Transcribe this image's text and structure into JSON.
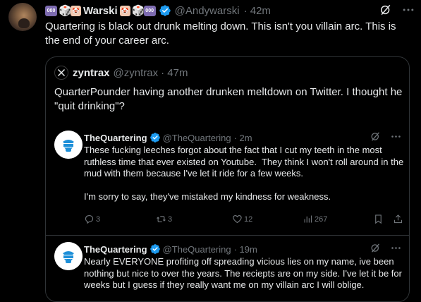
{
  "tweet": {
    "display_name": "Warski",
    "handle": "@Andywarski",
    "time": "· 42m",
    "name_emojis": [
      "000",
      "🎲",
      "🤡",
      "🤡",
      "🎲",
      "000"
    ],
    "text": "Quartering is black out drunk melting down. This isn't you villain arc. This is the end of your career arc."
  },
  "quote": {
    "display_name": "zyntrax",
    "handle": "@zyntrax",
    "time": "· 47m",
    "text": "QuarterPounder having another drunken meltdown on Twitter. I thought he \"quit drinking\"?"
  },
  "inner_tweets": [
    {
      "display_name": "TheQuartering",
      "handle": "@TheQuartering",
      "time": "· 2m",
      "text": "These fucking leeches forgot about the fact that I cut my teeth in the most ruthless time that ever existed on Youtube.  They think I won't roll around in the mud with them because I've let it ride for a few weeks.\n\nI'm sorry to say, they've mistaked my kindness for weakness.",
      "actions": {
        "replies": "3",
        "reposts": "3",
        "likes": "12",
        "views": "267"
      }
    },
    {
      "display_name": "TheQuartering",
      "handle": "@TheQuartering",
      "time": "· 19m",
      "text": "Nearly EVERYONE profiting off spreading vicious lies on my name, ive been nothing but nice to over the years. The reciepts are on my side. I've let it be for weeks but I guess if they really want me on my villain arc I will oblige."
    }
  ],
  "colors": {
    "background": "#000000",
    "text": "#e7e9ea",
    "muted": "#71767b",
    "border": "#2f3336",
    "verified_badge": "#1d9bf0"
  }
}
